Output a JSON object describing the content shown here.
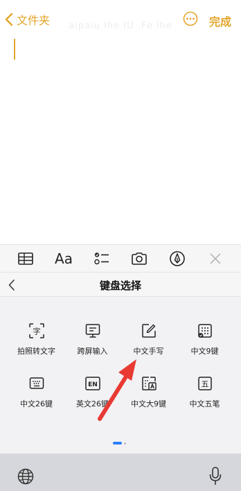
{
  "nav": {
    "back_label": "文件夹",
    "done_label": "完成",
    "watermark": "aipaiu Ihe IU .Fe lhe"
  },
  "toolbar": {
    "format_label": "Aa"
  },
  "keyboard": {
    "title": "键盘选择",
    "items": [
      {
        "label": "拍照转文字",
        "icon": "photo-to-text-icon",
        "glyph": "字"
      },
      {
        "label": "跨屏输入",
        "icon": "cross-screen-icon"
      },
      {
        "label": "中文手写",
        "icon": "handwriting-icon"
      },
      {
        "label": "中文9键",
        "icon": "keypad-9-icon"
      },
      {
        "label": "中文26键",
        "icon": "keyboard-26-icon"
      },
      {
        "label": "英文26键",
        "icon": "english-keyboard-icon",
        "glyph": "EN"
      },
      {
        "label": "中文大9键",
        "icon": "large-9-key-icon"
      },
      {
        "label": "中文五笔",
        "icon": "wubi-icon",
        "glyph": "五"
      }
    ]
  },
  "colors": {
    "accent": "#e2a52a",
    "annotation_arrow": "#e83a33",
    "page_indicator": "#2b7fff"
  }
}
